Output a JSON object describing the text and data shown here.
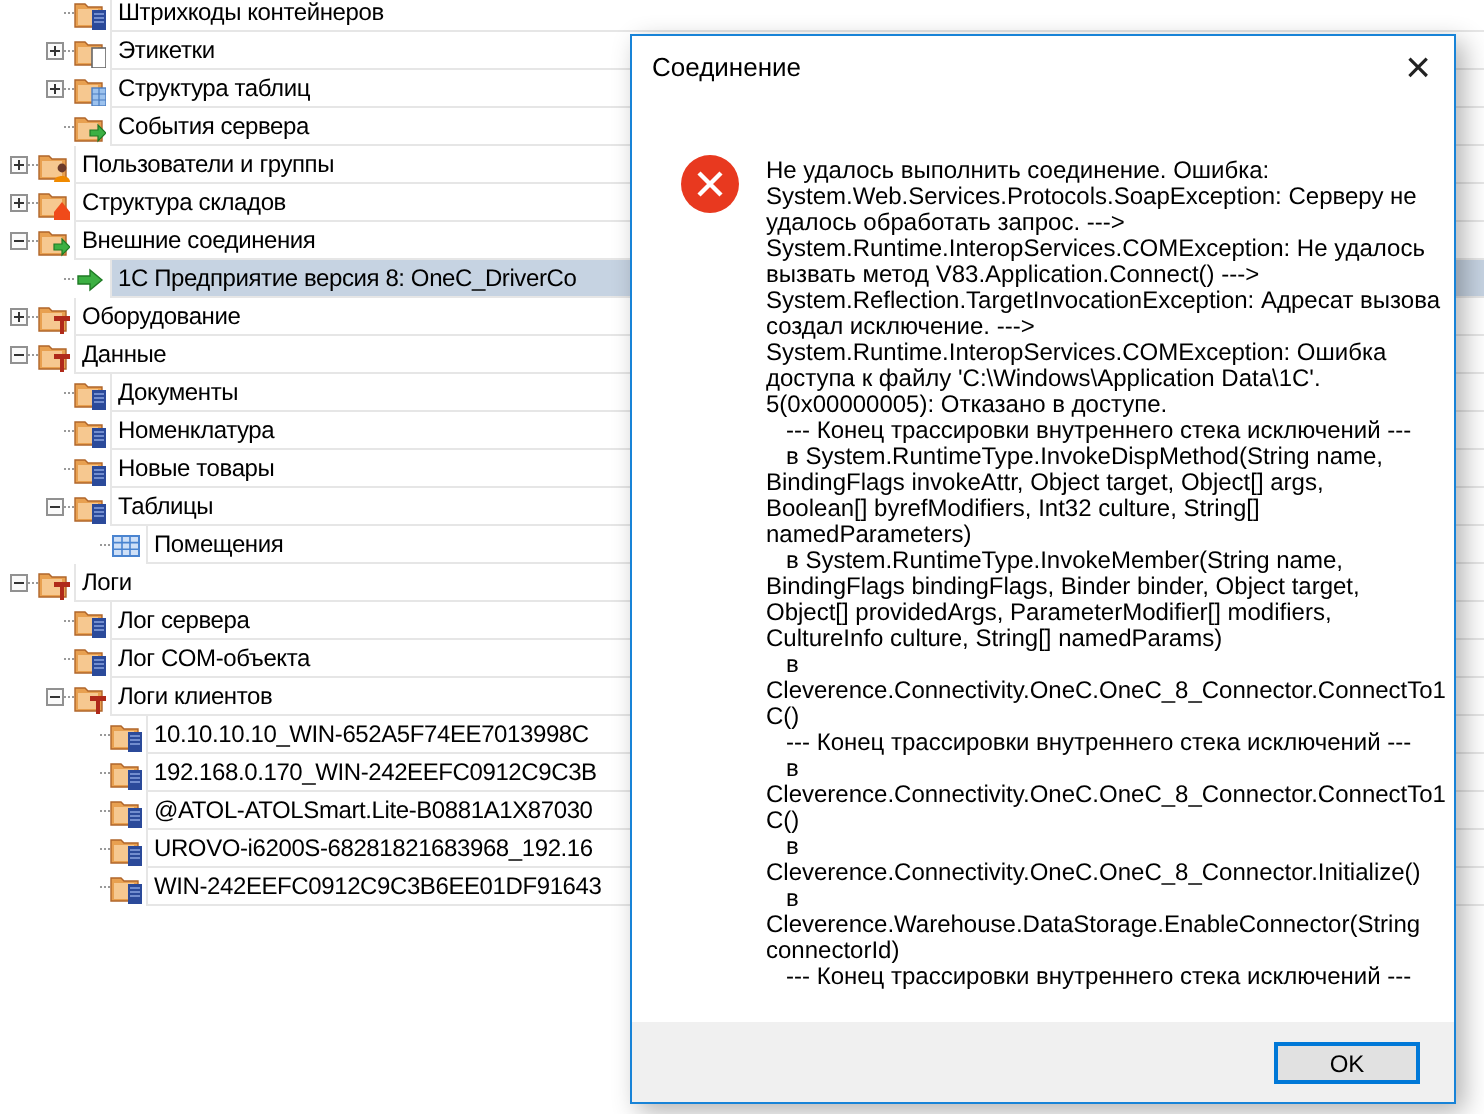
{
  "tree_continued": [
    {
      "label": "Штрихкоды контейнеров",
      "kind": "folder-doc"
    },
    {
      "label": "Этикетки",
      "kind": "folder-page",
      "expanded": false
    },
    {
      "label": "Структура таблиц",
      "kind": "folder-grid",
      "expanded": false
    },
    {
      "label": "События сервера",
      "kind": "folder-arrow"
    }
  ],
  "tree": [
    {
      "label": "Пользователи и группы",
      "kind": "folder-person",
      "expanded": false,
      "selected": false
    },
    {
      "label": "Структура складов",
      "kind": "folder-house",
      "expanded": false,
      "selected": false
    },
    {
      "label": "Внешние соединения",
      "kind": "folder-arrow",
      "expanded": true,
      "selected": false,
      "children": [
        {
          "label": "1С Предприятие версия 8: OneC_DriverCo",
          "kind": "arrow",
          "selected": true
        }
      ]
    },
    {
      "label": "Оборудование",
      "kind": "folder-tool",
      "expanded": false,
      "selected": false
    },
    {
      "label": "Данные",
      "kind": "folder-tool",
      "expanded": true,
      "selected": false,
      "children": [
        {
          "label": "Документы",
          "kind": "folder-doc",
          "selected": false
        },
        {
          "label": "Номенклатура",
          "kind": "folder-doc",
          "selected": false
        },
        {
          "label": "Новые товары",
          "kind": "folder-doc",
          "selected": false
        },
        {
          "label": "Таблицы",
          "kind": "folder-doc",
          "expanded": true,
          "selected": false,
          "children": [
            {
              "label": "Помещения",
              "kind": "table",
              "selected": false
            }
          ]
        }
      ]
    },
    {
      "label": "Логи",
      "kind": "folder-tool",
      "expanded": true,
      "selected": false,
      "children": [
        {
          "label": "Лог сервера",
          "kind": "folder-doc",
          "selected": false
        },
        {
          "label": "Лог COM-объекта",
          "kind": "folder-doc",
          "selected": false
        },
        {
          "label": "Логи клиентов",
          "kind": "folder-tool",
          "expanded": true,
          "selected": false,
          "children": [
            {
              "label": "10.10.10.10_WIN-652A5F74EE7013998C",
              "kind": "folder-doc",
              "selected": false
            },
            {
              "label": "192.168.0.170_WIN-242EEFC0912C9C3B",
              "kind": "folder-doc",
              "selected": false
            },
            {
              "label": "@ATOL-ATOLSmart.Lite-B0881A1X87030",
              "kind": "folder-doc",
              "selected": false
            },
            {
              "label": "UROVO-i6200S-68281821683968_192.16",
              "kind": "folder-doc",
              "selected": false
            },
            {
              "label": "WIN-242EEFC0912C9C3B6EE01DF91643",
              "kind": "folder-doc",
              "selected": false
            }
          ]
        }
      ]
    }
  ],
  "dialog": {
    "title": "Соединение",
    "close": "×",
    "message": "Не удалось выполнить соединение. Ошибка:\nSystem.Web.Services.Protocols.SoapException: Серверу не\nудалось обработать запрос. --->\nSystem.Runtime.InteropServices.COMException: Не удалось\nвызвать метод V83.Application.Connect() --->\nSystem.Reflection.TargetInvocationException: Адресат вызова\nсоздал исключение. --->\nSystem.Runtime.InteropServices.COMException: Ошибка\nдоступа к файлу 'C:\\Windows\\Application Data\\1C'.\n5(0x00000005): Отказано в доступе.\n   --- Конец трассировки внутреннего стека исключений ---\n   в System.RuntimeType.InvokeDispMethod(String name,\nBindingFlags invokeAttr, Object target, Object[] args,\nBoolean[] byrefModifiers, Int32 culture, String[]\nnamedParameters)\n   в System.RuntimeType.InvokeMember(String name,\nBindingFlags bindingFlags, Binder binder, Object target,\nObject[] providedArgs, ParameterModifier[] modifiers,\nCultureInfo culture, String[] namedParams)\n   в\nCleverence.Connectivity.OneC.OneC_8_Connector.ConnectTo1\nC()\n   --- Конец трассировки внутреннего стека исключений ---\n   в\nCleverence.Connectivity.OneC.OneC_8_Connector.ConnectTo1\nC()\n   в\nCleverence.Connectivity.OneC.OneC_8_Connector.Initialize()\n   в\nCleverence.Warehouse.DataStorage.EnableConnector(String\nconnectorId)\n   --- Конец трассировки внутреннего стека исключений ---",
    "buttons": [
      {
        "label": "OK",
        "default": true
      }
    ]
  }
}
